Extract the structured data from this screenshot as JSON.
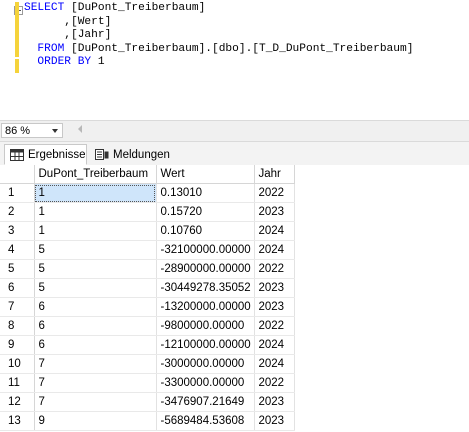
{
  "editor": {
    "lines": [
      {
        "kw": "SELECT",
        "rest": " [DuPont_Treiberbaum]"
      },
      {
        "kw": "",
        "rest": "      ,[Wert]"
      },
      {
        "kw": "",
        "rest": "      ,[Jahr]"
      },
      {
        "kw": "  FROM",
        "rest": " [DuPont_Treiberbaum].[dbo].[T_D_DuPont_Treiberbaum]"
      },
      {
        "kw": "  ORDER BY",
        "rest": " 1"
      }
    ]
  },
  "zoom": {
    "value": "86 %"
  },
  "tabs": [
    {
      "label": "Ergebnisse",
      "icon": "grid-results-icon",
      "active": true
    },
    {
      "label": "Meldungen",
      "icon": "messages-icon",
      "active": false
    }
  ],
  "grid": {
    "columns": [
      "DuPont_Treiberbaum",
      "Wert",
      "Jahr"
    ],
    "rows": [
      {
        "n": "1",
        "cells": [
          "1",
          "0.13010",
          "2022"
        ]
      },
      {
        "n": "2",
        "cells": [
          "1",
          "0.15720",
          "2023"
        ]
      },
      {
        "n": "3",
        "cells": [
          "1",
          "0.10760",
          "2024"
        ]
      },
      {
        "n": "4",
        "cells": [
          "5",
          "-32100000.00000",
          "2024"
        ]
      },
      {
        "n": "5",
        "cells": [
          "5",
          "-28900000.00000",
          "2022"
        ]
      },
      {
        "n": "6",
        "cells": [
          "5",
          "-30449278.35052",
          "2023"
        ]
      },
      {
        "n": "7",
        "cells": [
          "6",
          "-13200000.00000",
          "2023"
        ]
      },
      {
        "n": "8",
        "cells": [
          "6",
          "-9800000.00000",
          "2022"
        ]
      },
      {
        "n": "9",
        "cells": [
          "6",
          "-12100000.00000",
          "2024"
        ]
      },
      {
        "n": "10",
        "cells": [
          "7",
          "-3000000.00000",
          "2024"
        ]
      },
      {
        "n": "11",
        "cells": [
          "7",
          "-3300000.00000",
          "2022"
        ]
      },
      {
        "n": "12",
        "cells": [
          "7",
          "-3476907.21649",
          "2023"
        ]
      },
      {
        "n": "13",
        "cells": [
          "9",
          "-5689484.53608",
          "2023"
        ]
      }
    ]
  },
  "colors": {
    "keyword": "#0000ff",
    "selected_cell": "#cfe5fa",
    "change_marker": "#f5d33b"
  }
}
